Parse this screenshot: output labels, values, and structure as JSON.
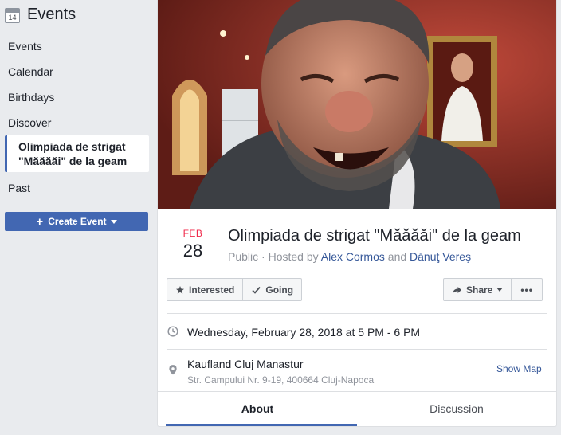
{
  "sidebar": {
    "icon_day": "14",
    "title": "Events",
    "items": [
      {
        "label": "Events"
      },
      {
        "label": "Calendar"
      },
      {
        "label": "Birthdays"
      },
      {
        "label": "Discover"
      },
      {
        "label": "Olimpiada de strigat \"Măăăăi\" de la geam"
      },
      {
        "label": "Past"
      }
    ],
    "create_button": "Create Event"
  },
  "event": {
    "month": "FEB",
    "day": "28",
    "title": "Olimpiada de strigat \"Măăăăi\" de la geam",
    "privacy": "Public",
    "hosted_by_prefix": "· Hosted by",
    "host1": "Alex Cormos",
    "and": "and",
    "host2": "Dănuţ Vereş",
    "datetime": "Wednesday, February 28, 2018 at 5 PM - 6 PM",
    "location_name": "Kaufland Cluj Manastur",
    "location_address": "Str. Campului Nr. 9-19, 400664 Cluj-Napoca",
    "show_map": "Show Map"
  },
  "actions": {
    "interested": "Interested",
    "going": "Going",
    "share": "Share",
    "more": "•••"
  },
  "tabs": [
    {
      "label": "About"
    },
    {
      "label": "Discussion"
    }
  ],
  "colors": {
    "brand": "#4267b2",
    "link": "#365899",
    "month_red": "#f02849",
    "sidebar_bg": "#e9ebee"
  }
}
